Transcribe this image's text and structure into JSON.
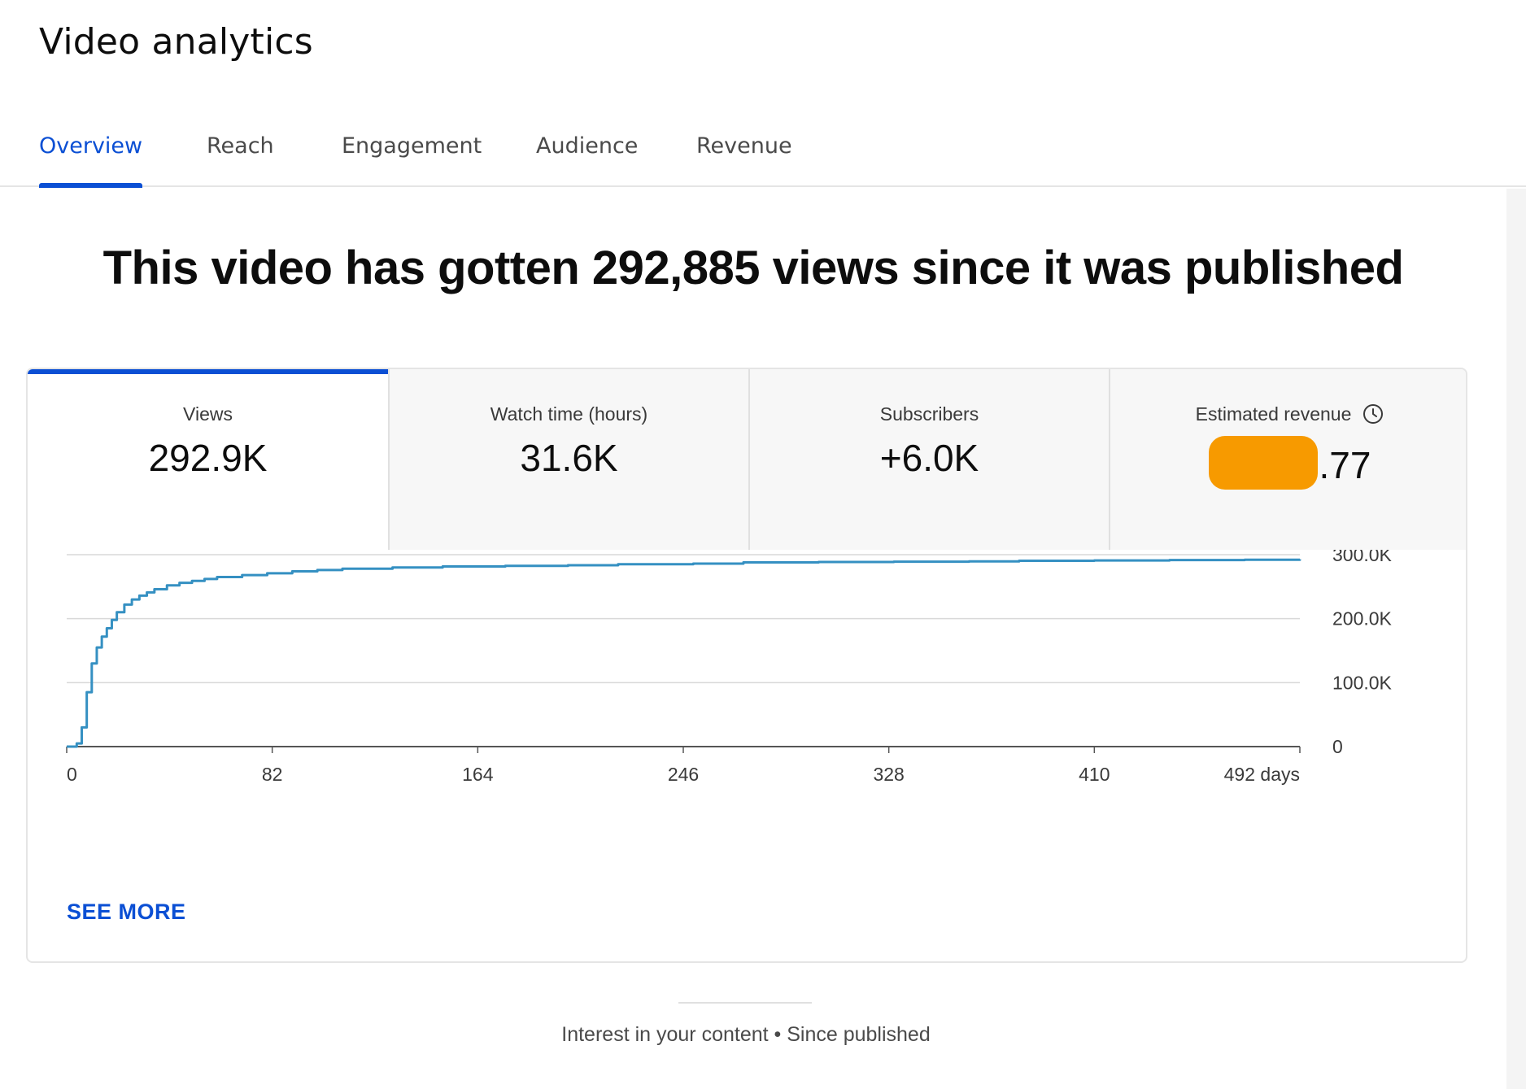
{
  "page": {
    "title": "Video analytics"
  },
  "tabs": [
    {
      "label": "Overview",
      "active": true
    },
    {
      "label": "Reach",
      "active": false
    },
    {
      "label": "Engagement",
      "active": false
    },
    {
      "label": "Audience",
      "active": false
    },
    {
      "label": "Revenue",
      "active": false
    }
  ],
  "headline": "This video has gotten 292,885 views since it was published",
  "metrics": [
    {
      "label": "Views",
      "value": "292.9K",
      "active": true
    },
    {
      "label": "Watch time (hours)",
      "value": "31.6K",
      "active": false
    },
    {
      "label": "Subscribers",
      "value": "+6.0K",
      "active": false
    },
    {
      "label": "Estimated revenue",
      "value": ".77",
      "active": false,
      "icon": "clock-icon",
      "redacted": true
    }
  ],
  "colors": {
    "accent": "#0b4fd4",
    "line": "#3590c2",
    "redaction": "#f79a00",
    "grid": "#d9d9d9"
  },
  "chart_data": {
    "type": "line",
    "x_ticks": [
      "0",
      "82",
      "164",
      "246",
      "328",
      "410",
      "492 days"
    ],
    "y_ticks": [
      "0",
      "100.0K",
      "200.0K",
      "300.0K"
    ],
    "xlim": [
      0,
      492
    ],
    "ylim": [
      0,
      300000
    ],
    "grid": true,
    "series": [
      {
        "x": [
          0,
          2,
          4,
          6,
          8,
          10,
          12,
          14,
          16,
          18,
          20,
          23,
          26,
          29,
          32,
          35,
          40,
          45,
          50,
          55,
          60,
          70,
          80,
          90,
          100,
          110,
          130,
          150,
          175,
          200,
          220,
          250,
          270,
          300,
          330,
          360,
          380,
          410,
          440,
          470,
          492
        ],
        "y": [
          0,
          0,
          5000,
          30000,
          85000,
          130000,
          155000,
          172000,
          185000,
          198000,
          210000,
          222000,
          230000,
          236000,
          241000,
          246000,
          252000,
          256000,
          259000,
          262000,
          265000,
          268000,
          271000,
          274000,
          276000,
          278000,
          280000,
          281500,
          282500,
          283500,
          285000,
          286000,
          288000,
          288500,
          289000,
          289500,
          290500,
          291000,
          291500,
          292000,
          292885
        ]
      }
    ]
  },
  "actions": {
    "see_more": "SEE MORE"
  },
  "footer": {
    "text": "Interest in your content • Since published"
  }
}
